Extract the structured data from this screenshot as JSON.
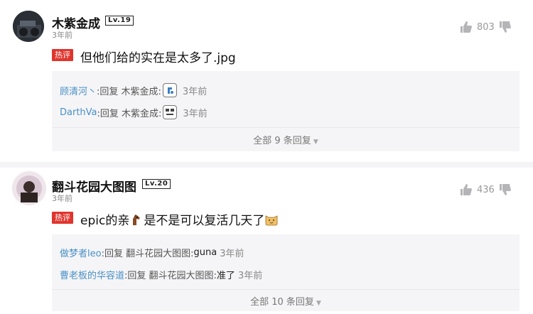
{
  "comments": [
    {
      "username": "木紫金成",
      "level": "Lv.19",
      "time": "3年前",
      "hot_badge": "热评",
      "content": "但他们给的实在是太多了.jpg",
      "likes": "803",
      "replies": [
        {
          "name": "顾清河丶",
          "text": ":回复 木紫金成:",
          "body": "",
          "time": "3年前",
          "emoji": "square-face"
        },
        {
          "name": "DarthVa",
          "text": ":回复 木紫金成:",
          "body": "",
          "time": "3年前",
          "emoji": "square-face"
        }
      ],
      "more": "全部 9 条回复"
    },
    {
      "username": "翻斗花园大图图",
      "level": "Lv.20",
      "time": "3年前",
      "hot_badge": "热评",
      "content_a": "epic的亲",
      "content_b": "是不是可以复活几天了",
      "likes": "436",
      "replies": [
        {
          "name": "做梦者leo",
          "text": ":回复 翻斗花园大图图:",
          "body": " guna",
          "time": "3年前"
        },
        {
          "name": "曹老板的华容道",
          "text": ":回复 翻斗花园大图图:",
          "body": " 准了",
          "time": "3年前"
        }
      ],
      "more": "全部 10 条回复"
    }
  ],
  "colors": {
    "hot": "#e0342d",
    "reply_name": "#4a90c6",
    "reply_bg": "#f5f5f7"
  }
}
